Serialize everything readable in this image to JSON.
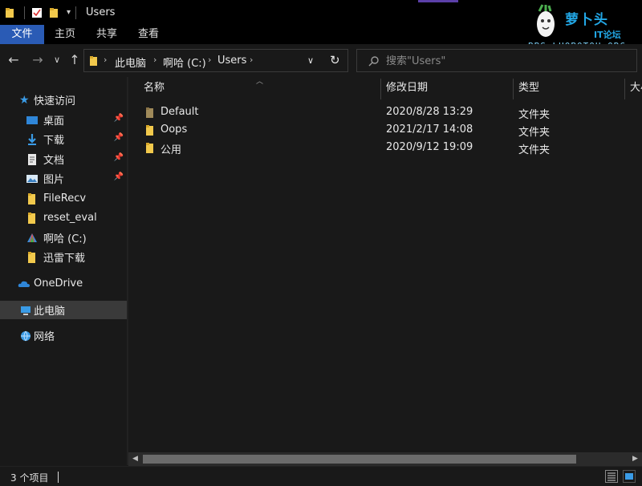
{
  "window": {
    "title": "Users"
  },
  "ribbon": {
    "tabs": [
      "文件",
      "主页",
      "共享",
      "查看"
    ]
  },
  "logo": {
    "name": "萝卜头",
    "tagline": "IT论坛",
    "url": "BBS.LUOBOTOU.ORG"
  },
  "address": {
    "crumbs": [
      "此电脑",
      "啊哈 (C:)",
      "Users"
    ]
  },
  "search": {
    "placeholder": "搜索\"Users\""
  },
  "sidebar": {
    "quick_access": "快速访问",
    "items": [
      {
        "label": "桌面",
        "pinned": true,
        "icon": "desktop-icon"
      },
      {
        "label": "下载",
        "pinned": true,
        "icon": "download-icon"
      },
      {
        "label": "文档",
        "pinned": true,
        "icon": "document-icon"
      },
      {
        "label": "图片",
        "pinned": true,
        "icon": "picture-icon"
      },
      {
        "label": "FileRecv",
        "pinned": false,
        "icon": "folder-icon"
      },
      {
        "label": "reset_eval",
        "pinned": false,
        "icon": "folder-icon"
      },
      {
        "label": "啊哈 (C:)",
        "pinned": false,
        "icon": "drive-icon"
      },
      {
        "label": "迅雷下载",
        "pinned": false,
        "icon": "folder-icon"
      }
    ],
    "onedrive": "OneDrive",
    "this_pc": "此电脑",
    "network": "网络"
  },
  "columns": {
    "name": "名称",
    "modified": "修改日期",
    "type": "类型",
    "size": "大小"
  },
  "files": [
    {
      "name": "Default",
      "modified": "2020/8/28 13:29",
      "type": "文件夹"
    },
    {
      "name": "Oops",
      "modified": "2021/2/17 14:08",
      "type": "文件夹"
    },
    {
      "name": "公用",
      "modified": "2020/9/12 19:09",
      "type": "文件夹"
    }
  ],
  "status": {
    "count": "3 个项目"
  },
  "colors": {
    "file_tab": "#2a5bb5",
    "folder": "#f2c94c",
    "folder_dim": "#a08a5a",
    "accent": "#1e90ff"
  }
}
